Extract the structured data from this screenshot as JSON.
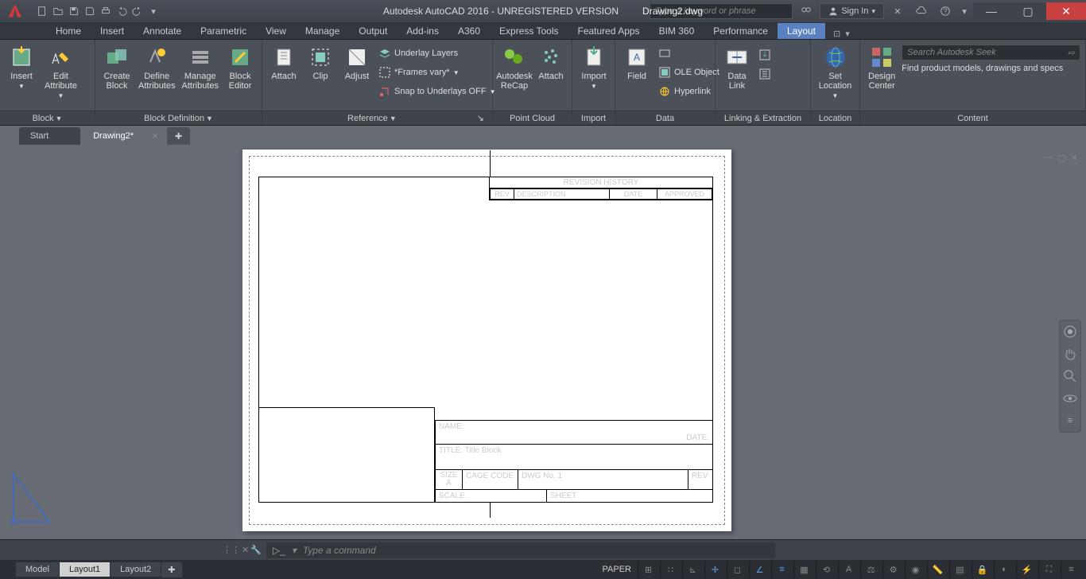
{
  "title": {
    "app": "Autodesk AutoCAD 2016 - UNREGISTERED VERSION",
    "doc": "Drawing2.dwg"
  },
  "search": {
    "placeholder": "Type a keyword or phrase"
  },
  "signin": "Sign In",
  "tabs": [
    "Home",
    "Insert",
    "Annotate",
    "Parametric",
    "View",
    "Manage",
    "Output",
    "Add-ins",
    "A360",
    "Express Tools",
    "Featured Apps",
    "BIM 360",
    "Performance",
    "Layout"
  ],
  "tabs_active": "Layout",
  "panels": {
    "block": {
      "title": "Block",
      "items": {
        "insert": "Insert",
        "editattr": "Edit\nAttribute"
      }
    },
    "blockdef": {
      "title": "Block Definition",
      "items": {
        "create": "Create\nBlock",
        "define": "Define\nAttributes",
        "manage": "Manage\nAttributes",
        "editor": "Block\nEditor"
      }
    },
    "reference": {
      "title": "Reference",
      "items": {
        "attach": "Attach",
        "clip": "Clip",
        "adjust": "Adjust",
        "under": "Underlay Layers",
        "frames": "*Frames vary*",
        "snap": "Snap to Underlays OFF"
      }
    },
    "pointcloud": {
      "title": "Point Cloud",
      "items": {
        "recap": "Autodesk\nReCap",
        "attach": "Attach"
      }
    },
    "import": {
      "title": "Import",
      "items": {
        "import": "Import"
      }
    },
    "data": {
      "title": "Data",
      "items": {
        "field": "Field",
        "ole": "OLE Object",
        "hyper": "Hyperlink"
      }
    },
    "linking": {
      "title": "Linking & Extraction",
      "items": {
        "datalink": "Data\nLink"
      }
    },
    "location": {
      "title": "Location",
      "items": {
        "set": "Set\nLocation"
      }
    },
    "content": {
      "title": "Content",
      "items": {
        "design": "Design\nCenter",
        "seek": "Search Autodesk Seek",
        "hint": "Find product models, drawings and specs"
      }
    }
  },
  "filetabs": {
    "start": "Start",
    "drawing": "Drawing2*"
  },
  "drawing": {
    "rev_title": "REVISION  HISTORY",
    "rev_cols": {
      "rev": "REV",
      "desc": "DESCRIPTION",
      "date": "DATE",
      "appr": "APPROVED"
    },
    "tb": {
      "name": "NAME:",
      "date": "DATE:",
      "title": "TITLE: Title Block",
      "size": "SIZE",
      "size_v": "A",
      "cage": "CAGE CODE",
      "dwg": "DWG No. 1",
      "rev": "REV",
      "scale": "SCALE",
      "sheet": "SHEET"
    }
  },
  "cmd": {
    "placeholder": "Type a command"
  },
  "bottom": {
    "model": "Model",
    "l1": "Layout1",
    "l2": "Layout2"
  },
  "status": {
    "paper": "PAPER"
  }
}
